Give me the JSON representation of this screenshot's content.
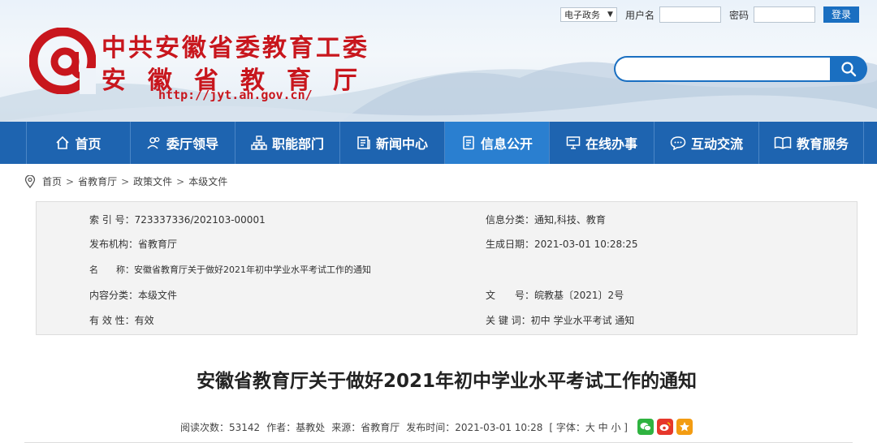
{
  "header": {
    "site_select": "电子政务",
    "username_label": "用户名",
    "password_label": "密码",
    "login_button": "登录",
    "org_line1": "中共安徽省委教育工委",
    "org_line2": "安徽省教育厅",
    "url": "http://jyt.ah.gov.cn/",
    "colors": {
      "brand_red": "#c8161d",
      "brand_blue": "#1a6fc1"
    }
  },
  "nav": {
    "items": [
      {
        "label": "首页",
        "icon": "home-icon"
      },
      {
        "label": "委厅领导",
        "icon": "people-icon"
      },
      {
        "label": "职能部门",
        "icon": "org-chart-icon"
      },
      {
        "label": "新闻中心",
        "icon": "news-icon"
      },
      {
        "label": "信息公开",
        "icon": "document-icon",
        "active": true
      },
      {
        "label": "在线办事",
        "icon": "monitor-icon"
      },
      {
        "label": "互动交流",
        "icon": "chat-icon"
      },
      {
        "label": "教育服务",
        "icon": "book-icon"
      }
    ]
  },
  "breadcrumb": [
    "首页",
    "省教育厅",
    "政策文件",
    "本级文件"
  ],
  "info": {
    "index_no": {
      "label": "索 引 号：",
      "value": "723337336/202103-00001"
    },
    "category": {
      "label": "信息分类：",
      "value": "通知,科技、教育"
    },
    "publisher": {
      "label": "发布机构：",
      "value": "省教育厅"
    },
    "created": {
      "label": "生成日期：",
      "value": "2021-03-01 10:28:25"
    },
    "name": {
      "label": "名　　称：",
      "value": "安徽省教育厅关于做好2021年初中学业水平考试工作的通知"
    },
    "content_type": {
      "label": "内容分类：",
      "value": "本级文件"
    },
    "doc_no": {
      "label": "文　　号：",
      "value": "皖教基〔2021〕2号"
    },
    "validity": {
      "label": "有 效 性：",
      "value": "有效"
    },
    "keywords": {
      "label": "关 键 词：",
      "value": "初中 学业水平考试 通知"
    }
  },
  "article": {
    "title": "安徽省教育厅关于做好2021年初中学业水平考试工作的通知",
    "views": "阅读次数：53142",
    "author": "作者：基教处",
    "source": "来源：省教育厅",
    "publish_time": "发布时间：2021-03-01 10:28",
    "font_size": "[ 字体：大 中 小 ]"
  }
}
